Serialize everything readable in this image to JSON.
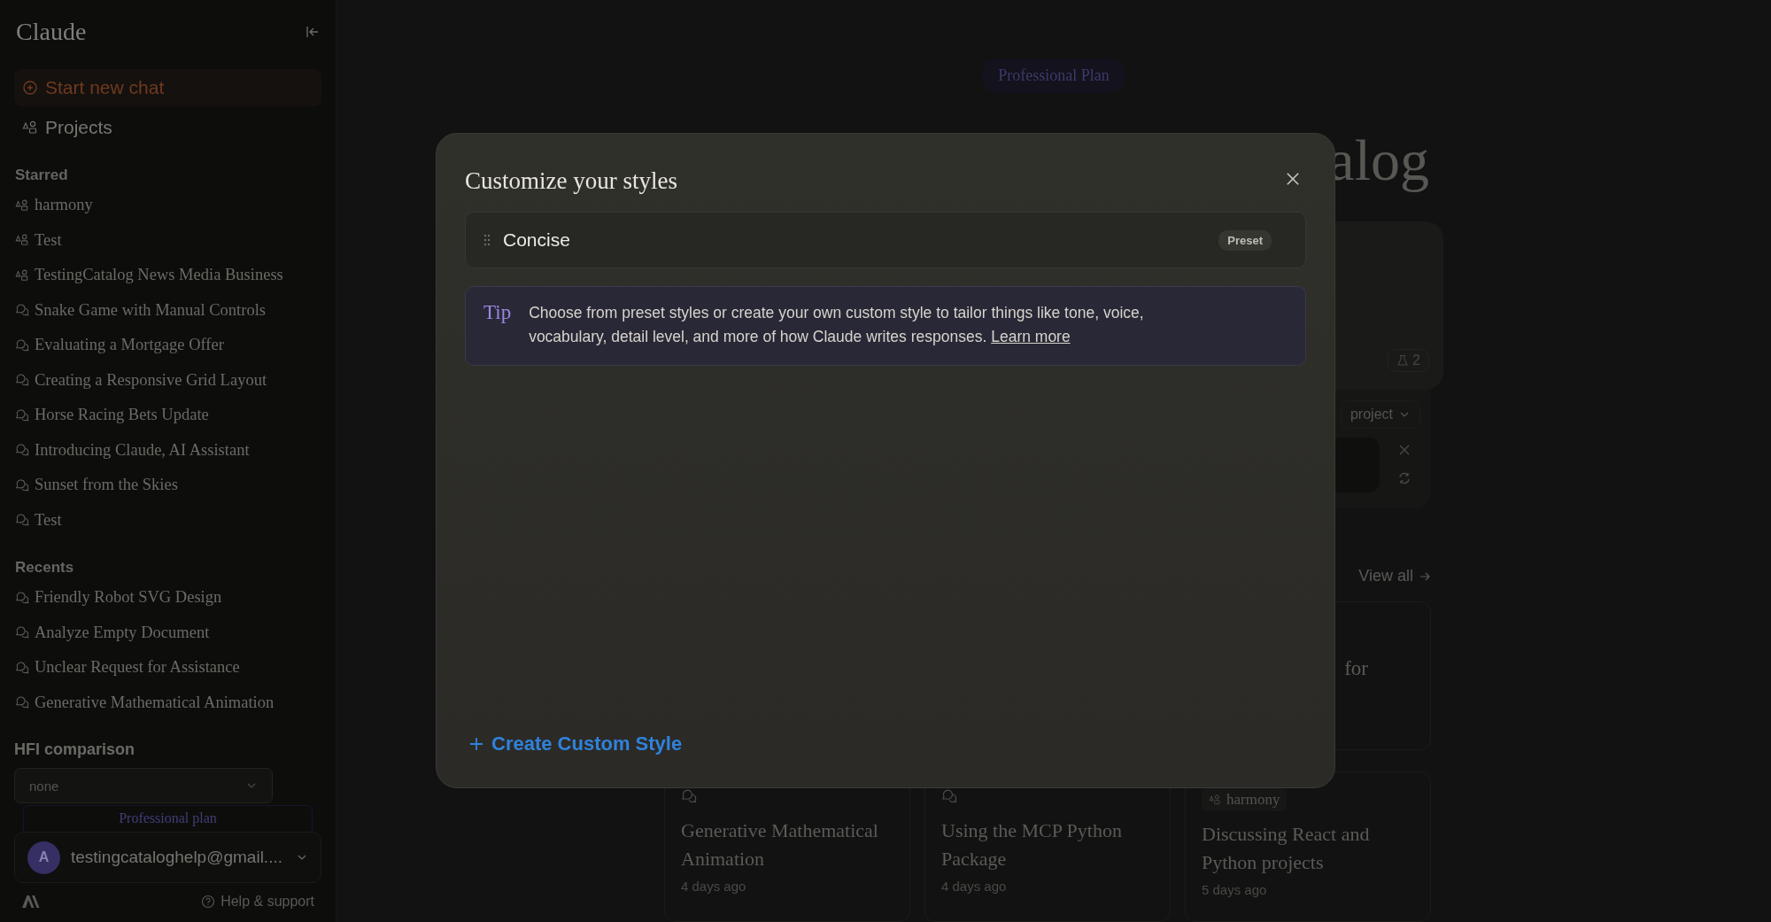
{
  "sidebar": {
    "title": "Claude",
    "new_chat": "Start new chat",
    "projects": "Projects",
    "starred": {
      "heading": "Starred",
      "items": [
        {
          "label": "harmony",
          "kind": "project"
        },
        {
          "label": "Test",
          "kind": "project"
        },
        {
          "label": "TestingCatalog News Media Business",
          "kind": "project"
        },
        {
          "label": "Snake Game with Manual Controls",
          "kind": "chat"
        },
        {
          "label": "Evaluating a Mortgage Offer",
          "kind": "chat"
        },
        {
          "label": "Creating a Responsive Grid Layout",
          "kind": "chat"
        },
        {
          "label": "Horse Racing Bets Update",
          "kind": "chat"
        },
        {
          "label": "Introducing Claude, AI Assistant",
          "kind": "chat"
        },
        {
          "label": "Sunset from the Skies",
          "kind": "chat"
        },
        {
          "label": "Test",
          "kind": "chat"
        }
      ]
    },
    "recents": {
      "heading": "Recents",
      "items": [
        {
          "label": "Friendly Robot SVG Design",
          "kind": "chat"
        },
        {
          "label": "Analyze Empty Document",
          "kind": "chat"
        },
        {
          "label": "Unclear Request for Assistance",
          "kind": "chat"
        },
        {
          "label": "Generative Mathematical Animation",
          "kind": "chat"
        }
      ]
    },
    "hfi": {
      "heading": "HFI comparison",
      "value": "none"
    },
    "plan": "Professional plan",
    "account": {
      "avatar": "A",
      "email": "testingcataloghelp@gmail...."
    },
    "help": "Help & support"
  },
  "main": {
    "plan_badge": "Professional Plan",
    "title": "alog",
    "usage_count": "2",
    "project_select": "project",
    "view_all": "View all",
    "card_text": "for",
    "recent_cards": [
      {
        "kind": "chat",
        "title": "Generative Mathematical Animation",
        "time": "4 days ago"
      },
      {
        "kind": "chat",
        "title": "Using the MCP Python Package",
        "time": "4 days ago"
      },
      {
        "kind": "project",
        "tag": "harmony",
        "title": "Discussing React and Python projects",
        "time": "5 days ago"
      }
    ]
  },
  "modal": {
    "title": "Customize your styles",
    "styles": [
      {
        "name": "Concise",
        "badge": "Preset"
      }
    ],
    "tip": {
      "label": "Tip",
      "text": "Choose from preset styles or create your own custom style to tailor things like tone, voice, vocabulary, detail level, and more of how Claude writes responses.",
      "link": "Learn more"
    },
    "create_button": "Create Custom Style"
  }
}
